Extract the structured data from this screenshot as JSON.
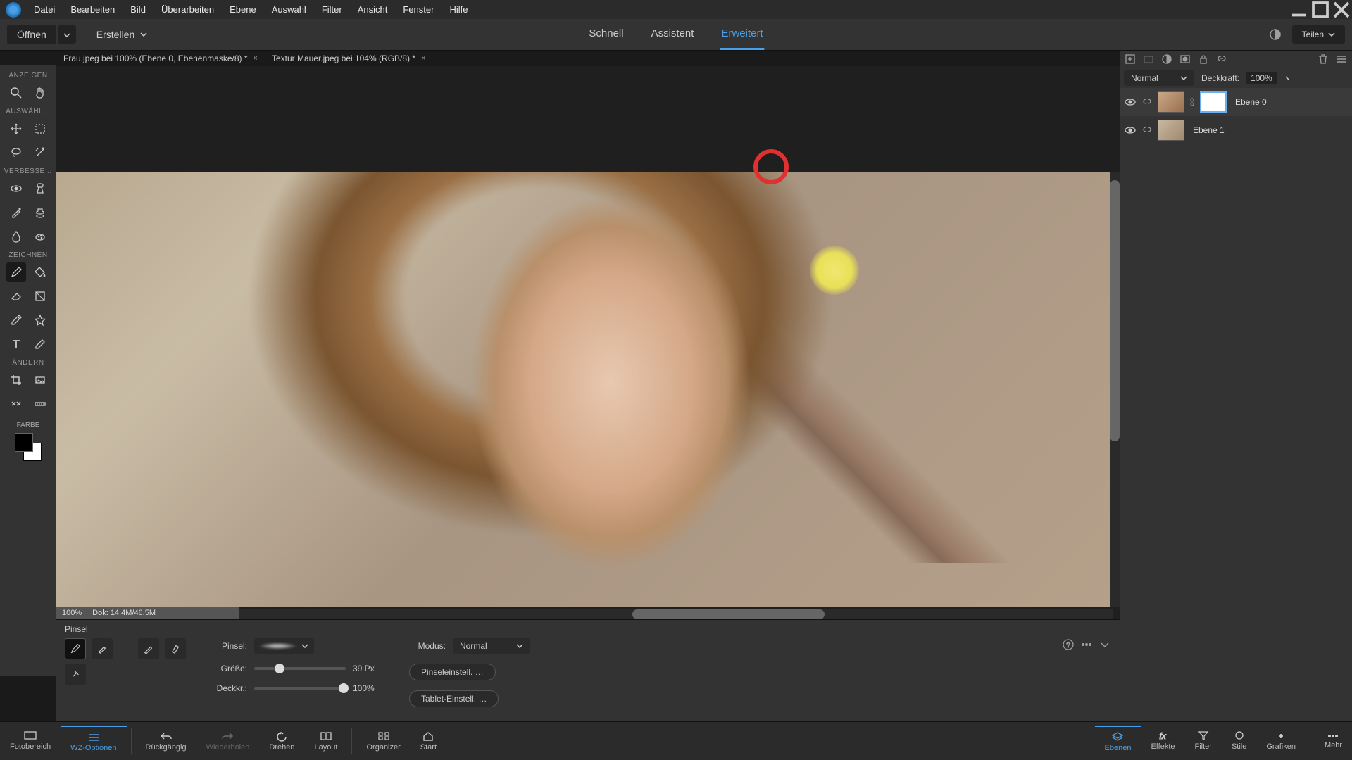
{
  "menu": [
    "Datei",
    "Bearbeiten",
    "Bild",
    "Überarbeiten",
    "Ebene",
    "Auswahl",
    "Filter",
    "Ansicht",
    "Fenster",
    "Hilfe"
  ],
  "actions": {
    "open": "Öffnen",
    "create": "Erstellen",
    "share": "Teilen"
  },
  "modes": {
    "quick": "Schnell",
    "assistant": "Assistent",
    "advanced": "Erweitert"
  },
  "docs": [
    {
      "title": "Frau.jpeg bei 100% (Ebene 0, Ebenenmaske/8) *"
    },
    {
      "title": "Textur Mauer.jpeg bei 104% (RGB/8) *"
    }
  ],
  "toolSections": {
    "view": "ANZEIGEN",
    "select": "AUSWÄHL…",
    "enhance": "VERBESSE…",
    "draw": "ZEICHNEN",
    "modify": "ÄNDERN",
    "color": "FARBE"
  },
  "status": {
    "zoom": "100%",
    "doc": "Dok: 14,4M/46,5M"
  },
  "options": {
    "title": "Pinsel",
    "brushLabel": "Pinsel:",
    "modeLabel": "Modus:",
    "modeValue": "Normal",
    "sizeLabel": "Größe:",
    "sizeValue": "39 Px",
    "opacityLabel": "Deckkr.:",
    "opacityValue": "100%",
    "brushSettings": "Pinseleinstell. …",
    "tabletSettings": "Tablet-Einstell. …"
  },
  "bottomNav": {
    "photobin": "Fotobereich",
    "toolOptions": "WZ-Optionen",
    "undo": "Rückgängig",
    "redo": "Wiederholen",
    "rotate": "Drehen",
    "layout": "Layout",
    "organizer": "Organizer",
    "start": "Start",
    "layers": "Ebenen",
    "effects": "Effekte",
    "filter": "Filter",
    "styles": "Stile",
    "graphics": "Grafiken",
    "more": "Mehr"
  },
  "layersPanel": {
    "blendMode": "Normal",
    "opacityLabel": "Deckkraft:",
    "opacityValue": "100%",
    "layers": [
      {
        "name": "Ebene 0"
      },
      {
        "name": "Ebene 1"
      }
    ]
  }
}
